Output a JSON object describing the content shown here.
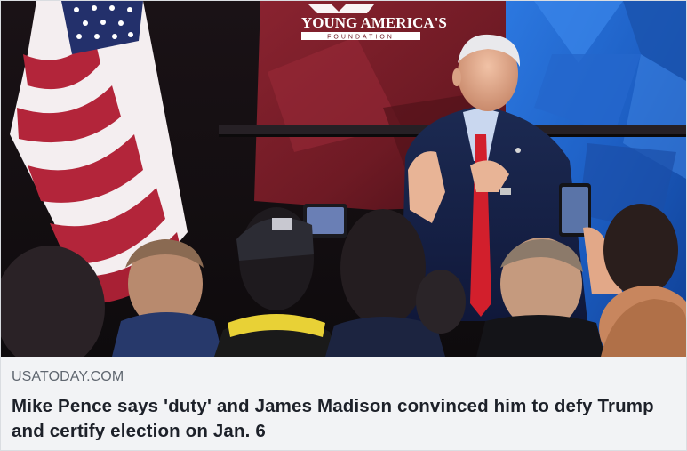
{
  "link_preview": {
    "image": {
      "banner_text": "YOUNG AMERICA'S",
      "banner_subtext": "FOUNDATION"
    },
    "domain": "USATODAY.COM",
    "headline": "Mike Pence says 'duty' and James Madison convinced him to defy Trump and certify election on Jan. 6"
  },
  "colors": {
    "caption_background": "#f2f3f5",
    "domain_text": "#606770",
    "headline_text": "#1d2129",
    "banner_red": "#6e1a24",
    "backdrop_blue": "#1d5fc4"
  }
}
